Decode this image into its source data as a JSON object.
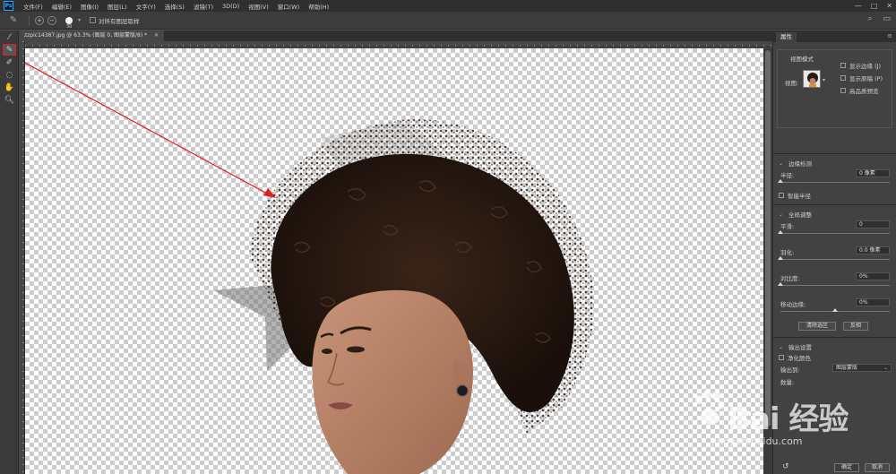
{
  "app": {
    "logo": "Ps"
  },
  "menu": [
    "文件(F)",
    "编辑(E)",
    "图像(I)",
    "图层(L)",
    "文字(Y)",
    "选择(S)",
    "滤镜(T)",
    "3D(D)",
    "视图(V)",
    "窗口(W)",
    "帮助(H)"
  ],
  "window_controls": {
    "minimize": "—",
    "maximize": "□",
    "close": "✕"
  },
  "options": {
    "brush_size": "30",
    "sample_all_layers": "对所有图层取样"
  },
  "document": {
    "tab_title": "zzpic14387.jpg @ 63.3% (图层 0, 图层蒙版/8) *"
  },
  "properties": {
    "tab": "属性",
    "view_mode": {
      "title": "视图模式",
      "view_label": "视图:",
      "show_edge": "显示边缘 (J)",
      "show_original": "显示原稿 (P)",
      "hq_preview": "高品质预览"
    },
    "edge_detection": {
      "title": "边缘检测",
      "radius_label": "半径:",
      "radius_value": "0 像素",
      "radius_fraction": 0.0,
      "smart_radius": "智能半径"
    },
    "global_refinement": {
      "title": "全局调整",
      "smooth_label": "平滑:",
      "smooth_value": "0",
      "smooth_fraction": 0.0,
      "feather_label": "羽化:",
      "feather_value": "0.0 像素",
      "feather_fraction": 0.0,
      "contrast_label": "对比度:",
      "contrast_value": "0%",
      "contrast_fraction": 0.0,
      "shift_edge_label": "移动边缘:",
      "shift_edge_value": "0%",
      "shift_edge_fraction": 0.5,
      "clear_selection": "清除选区",
      "invert": "反相"
    },
    "output": {
      "title": "输出设置",
      "decontaminate": "净化颜色",
      "output_to_label": "输出到:",
      "output_to_value": "图层蒙版",
      "amount_label": "数量:"
    },
    "ok": "确定",
    "cancel": "取消"
  },
  "watermark": {
    "brand": "Bai  经验",
    "url": "jingyan.baidu.com"
  },
  "colors": {
    "annotation_red": "#e02020",
    "hair": "#2a1a12",
    "skin": "#b98468"
  }
}
